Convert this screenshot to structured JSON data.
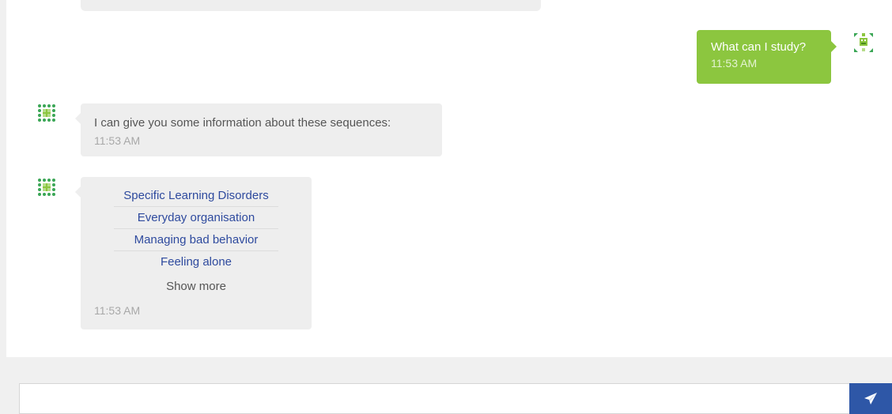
{
  "messages": {
    "user_question": {
      "text": "What can I study?",
      "time": "11:53 AM"
    },
    "bot_info": {
      "text": "I can give you some information about these sequences:",
      "time": "11:53 AM"
    },
    "bot_options": {
      "options": [
        "Specific Learning Disorders",
        "Everyday organisation",
        "Managing bad behavior",
        "Feeling alone"
      ],
      "show_more": "Show more",
      "time": "11:53 AM"
    }
  },
  "composer": {
    "value": "",
    "placeholder": ""
  },
  "icons": {
    "user_avatar": "robot-avatar-icon",
    "bot_avatar": "bot-grid-avatar-icon",
    "send": "paper-plane-icon"
  },
  "colors": {
    "user_bubble": "#8cc63f",
    "bot_bubble": "#eeeeee",
    "link": "#2e4a9e",
    "send_button": "#2e57a7"
  }
}
